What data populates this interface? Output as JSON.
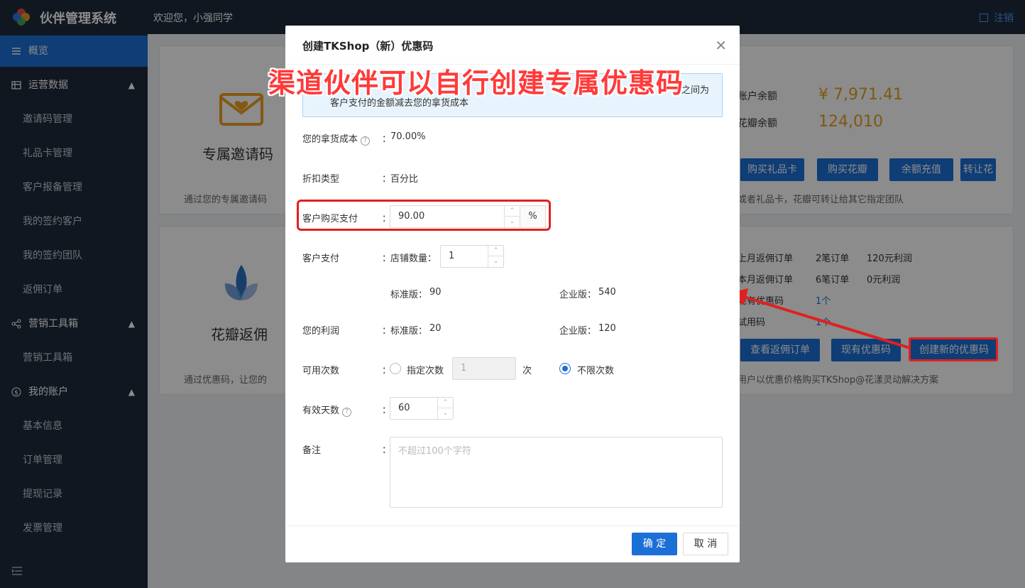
{
  "header": {
    "app_title": "伙伴管理系统",
    "welcome": "欢迎您，小强同学",
    "logout": "注销"
  },
  "sidebar": {
    "items": [
      {
        "label": "概览",
        "type": "group",
        "active": true
      },
      {
        "label": "运营数据",
        "type": "group"
      },
      {
        "label": "邀请码管理",
        "type": "sub"
      },
      {
        "label": "礼品卡管理",
        "type": "sub"
      },
      {
        "label": "客户报备管理",
        "type": "sub"
      },
      {
        "label": "我的签约客户",
        "type": "sub"
      },
      {
        "label": "我的签约团队",
        "type": "sub"
      },
      {
        "label": "返佣订单",
        "type": "sub"
      },
      {
        "label": "营销工具箱",
        "type": "group"
      },
      {
        "label": "营销工具箱",
        "type": "sub"
      },
      {
        "label": "我的账户",
        "type": "group"
      },
      {
        "label": "基本信息",
        "type": "sub"
      },
      {
        "label": "订单管理",
        "type": "sub"
      },
      {
        "label": "提现记录",
        "type": "sub"
      },
      {
        "label": "发票管理",
        "type": "sub"
      }
    ]
  },
  "background": {
    "card1_title": "专属邀请码",
    "card1_hint": "通过您的专属邀请码",
    "card2_title": "花瓣返佣",
    "card2_hint": "通过优惠码，让您的",
    "account_balance_label": "账户余额",
    "account_balance_value": "¥ 7,971.41",
    "petal_balance_label": "花瓣余额",
    "petal_balance_value": "124,010",
    "btn_buy_gift": "购买礼品卡",
    "btn_buy_petal": "购买花瓣",
    "btn_recharge": "余额充值",
    "btn_transfer": "转让花",
    "transfer_hint": "或者礼品卡，花瓣可转让给其它指定团队",
    "last_month_label": "上月返佣订单",
    "last_month_orders": "2笔订单",
    "last_month_profit": "120元利润",
    "this_month_label": "本月返佣订单",
    "this_month_orders": "6笔订单",
    "this_month_profit": "0元利润",
    "coupon_label": "现有优惠码",
    "coupon_value": "1个",
    "trial_label": "试用码",
    "trial_value": "1个",
    "btn_view_orders": "查看返佣订单",
    "btn_current_coupons": "现有优惠码",
    "btn_create_coupon": "创建新的优惠码",
    "coupon_hint": "用户以优惠价格购买TKShop@花漾灵动解决方案"
  },
  "modal": {
    "title": "创建TKShop（新）优惠码",
    "banner": "渠道伙伴可以自行创建专属优惠码",
    "notice_line2": "客户支付的金额减去您的拿货成本",
    "notice_tail": "之间为",
    "cost_label": "您的拿货成本",
    "cost_value": "70.00%",
    "discount_type_label": "折扣类型",
    "discount_type_value": "百分比",
    "customer_pay_pct_label": "客户购买支付",
    "customer_pay_pct_value": "90.00",
    "pct_unit": "%",
    "customer_pay_label": "客户支付",
    "shop_count_label": "店铺数量：",
    "shop_count_value": "1",
    "std_label": "标准版：",
    "std_pay": "90",
    "ent_label": "企业版：",
    "ent_pay": "540",
    "profit_label": "您的利润",
    "std_profit": "20",
    "ent_profit": "120",
    "usage_label": "可用次数",
    "usage_fixed_label": "指定次数",
    "usage_fixed_value": "1",
    "usage_unit": "次",
    "usage_unlimited_label": "不限次数",
    "valid_days_label": "有效天数",
    "valid_days_value": "60",
    "remark_label": "备注",
    "remark_placeholder": "不超过100个字符",
    "ok_button": "确 定",
    "cancel_button": "取 消",
    "colon": "："
  },
  "colors": {
    "primary": "#1c6fd6",
    "sidebar": "#1f2a3d",
    "highlight": "#e02020"
  }
}
